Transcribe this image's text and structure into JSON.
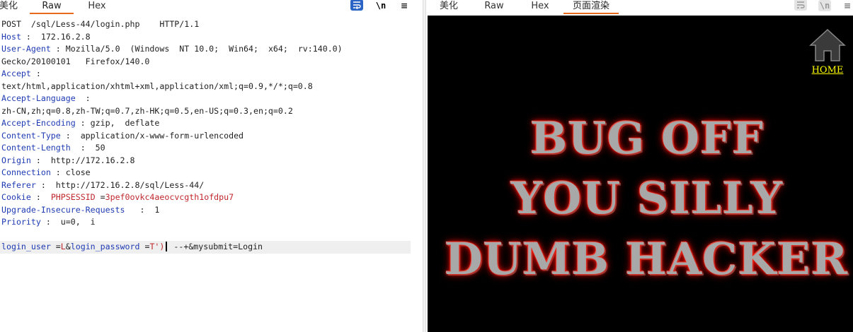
{
  "left_tabs": [
    "美化",
    "Raw",
    "Hex"
  ],
  "right_tabs": [
    "美化",
    "Raw",
    "Hex",
    "页面渲染"
  ],
  "icons": {
    "wrap": "wrap-lines-icon",
    "newline": "\\n",
    "menu": "menu-icon"
  },
  "request": {
    "request_line": "POST  /sql/Less-44/login.php    HTTP/1.1",
    "headers": [
      {
        "name": "Host",
        "sep": " :  ",
        "value": "172.16.2.8"
      },
      {
        "name": "User-Agent",
        "sep": " : ",
        "value": "Mozilla/5.0  (Windows  NT 10.0;  Win64;  x64;  rv:140.0)"
      },
      {
        "name": "",
        "sep": "",
        "value": "Gecko/20100101   Firefox/140.0"
      },
      {
        "name": "Accept",
        "sep": " :",
        "value": ""
      },
      {
        "name": "",
        "sep": "",
        "value": "text/html,application/xhtml+xml,application/xml;q=0.9,*/*;q=0.8"
      },
      {
        "name": "Accept-Language",
        "sep": "  :",
        "value": ""
      },
      {
        "name": "",
        "sep": "",
        "value": "zh-CN,zh;q=0.8,zh-TW;q=0.7,zh-HK;q=0.5,en-US;q=0.3,en;q=0.2"
      },
      {
        "name": "Accept-Encoding",
        "sep": " : ",
        "value": "gzip,  deflate"
      },
      {
        "name": "Content-Type",
        "sep": " :  ",
        "value": "application/x-www-form-urlencoded"
      },
      {
        "name": "Content-Length",
        "sep": "  :  ",
        "value": "50"
      },
      {
        "name": "Origin",
        "sep": " :  ",
        "value": "http://172.16.2.8"
      },
      {
        "name": "Connection",
        "sep": " : ",
        "value": "close"
      },
      {
        "name": "Referer",
        "sep": " :  ",
        "value": "http://172.16.2.8/sql/Less-44/"
      },
      {
        "name": "Cookie",
        "sep": " :  ",
        "value": "",
        "cookie_name": "PHPSESSID",
        "cookie_value": "3pef0ovkc4aeocvcgth1ofdpu7"
      },
      {
        "name": "Upgrade-Insecure-Requests",
        "sep": "   :  ",
        "value": "1"
      },
      {
        "name": "Priority",
        "sep": " :  ",
        "value": "u=0,  i"
      }
    ],
    "body": {
      "param1": "login_user",
      "eq1": " =",
      "val1": "L",
      "amp": "&",
      "param2": "login_password",
      "eq2": " =",
      "val2": "T')",
      "rest": " --+&mysubmit=Login"
    }
  },
  "render": {
    "home_label": "HOME",
    "banner_lines": [
      "BUG OFF",
      "YOU SILLY",
      "DUMB HACKER"
    ]
  }
}
